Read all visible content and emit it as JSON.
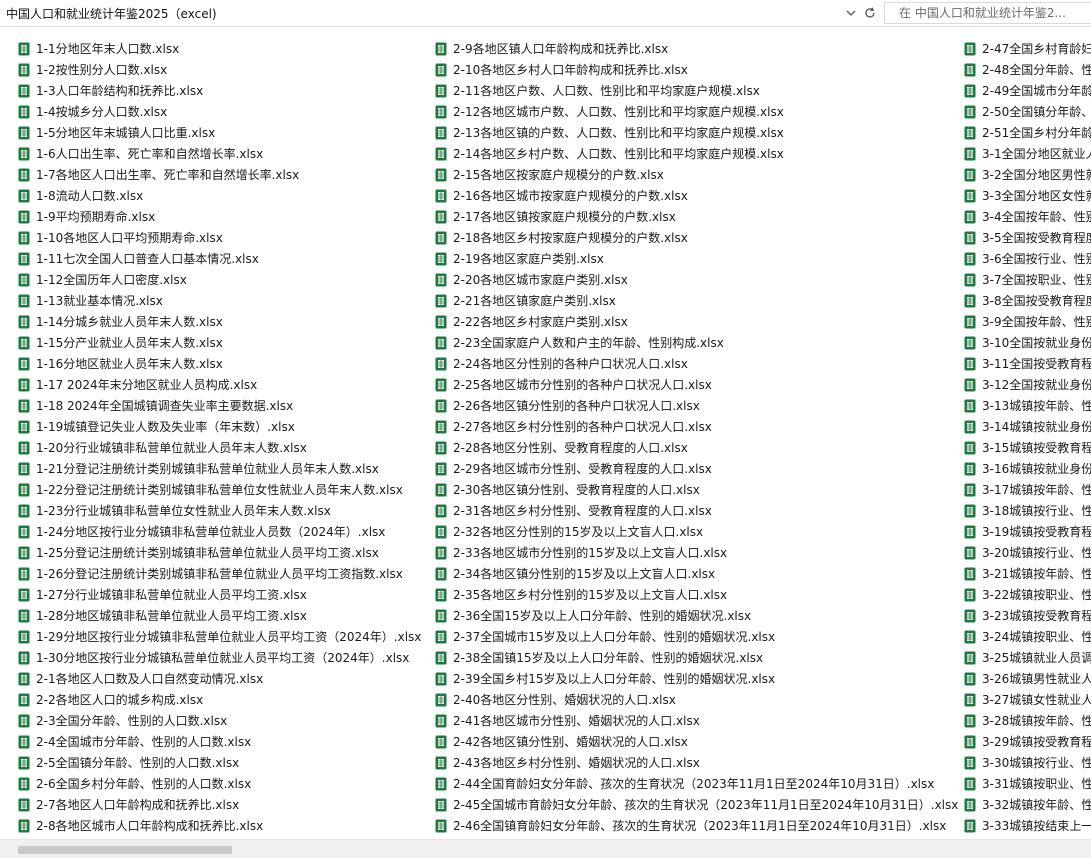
{
  "address_bar": {
    "path": "中国人口和就业统计年鉴2025（excel)",
    "search_placeholder": "在 中国人口和就业统计年鉴2..."
  },
  "icons": {
    "file_icon": "excel-file-icon",
    "dropdown": "chevron-down-icon",
    "refresh": "refresh-icon",
    "file_icon_color": "#1e7a3e"
  },
  "columns": [
    [
      "1-1分地区年末人口数.xlsx",
      "1-2按性别分人口数.xlsx",
      "1-3人口年龄结构和抚养比.xlsx",
      "1-4按城乡分人口数.xlsx",
      "1-5分地区年末城镇人口比重.xlsx",
      "1-6人口出生率、死亡率和自然增长率.xlsx",
      "1-7各地区人口出生率、死亡率和自然增长率.xlsx",
      "1-8流动人口数.xlsx",
      "1-9平均预期寿命.xlsx",
      "1-10各地区人口平均预期寿命.xlsx",
      "1-11七次全国人口普查人口基本情况.xlsx",
      "1-12全国历年人口密度.xlsx",
      "1-13就业基本情况.xlsx",
      "1-14分城乡就业人员年末人数.xlsx",
      "1-15分产业就业人员年末人数.xlsx",
      "1-16分地区就业人员年末人数.xlsx",
      "1-17 2024年末分地区就业人员构成.xlsx",
      "1-18 2024年全国城镇调查失业率主要数据.xlsx",
      "1-19城镇登记失业人数及失业率（年末数）.xlsx",
      "1-20分行业城镇非私营单位就业人员年末人数.xlsx",
      "1-21分登记注册统计类别城镇非私营单位就业人员年末人数.xlsx",
      "1-22分登记注册统计类别城镇非私营单位女性就业人员年末人数.xlsx",
      "1-23分行业城镇非私营单位女性就业人员年末人数.xlsx",
      "1-24分地区按行业分城镇非私营单位就业人员数（2024年）.xlsx",
      "1-25分登记注册统计类别城镇非私营单位就业人员平均工资.xlsx",
      "1-26分登记注册统计类别城镇非私营单位就业人员平均工资指数.xlsx",
      "1-27分行业城镇非私营单位就业人员平均工资.xlsx",
      "1-28分地区城镇非私营单位就业人员平均工资.xlsx",
      "1-29分地区按行业分城镇非私营单位就业人员平均工资（2024年）.xlsx",
      "1-30分地区按行业分城镇私营单位就业人员平均工资（2024年）.xlsx",
      "2-1各地区人口数及人口自然变动情况.xlsx",
      "2-2各地区人口的城乡构成.xlsx",
      "2-3全国分年龄、性别的人口数.xlsx",
      "2-4全国城市分年龄、性别的人口数.xlsx",
      "2-5全国镇分年龄、性别的人口数.xlsx",
      "2-6全国乡村分年龄、性别的人口数.xlsx",
      "2-7各地区人口年龄构成和抚养比.xlsx",
      "2-8各地区城市人口年龄构成和抚养比.xlsx"
    ],
    [
      "2-9各地区镇人口年龄构成和抚养比.xlsx",
      "2-10各地区乡村人口年龄构成和抚养比.xlsx",
      "2-11各地区户数、人口数、性别比和平均家庭户规模.xlsx",
      "2-12各地区城市户数、人口数、性别比和平均家庭户规模.xlsx",
      "2-13各地区镇的户数、人口数、性别比和平均家庭户规模.xlsx",
      "2-14各地区乡村户数、人口数、性别比和平均家庭户规模.xlsx",
      "2-15各地区按家庭户规模分的户数.xlsx",
      "2-16各地区城市按家庭户规模分的户数.xlsx",
      "2-17各地区镇按家庭户规模分的户数.xlsx",
      "2-18各地区乡村按家庭户规模分的户数.xlsx",
      "2-19各地区家庭户类别.xlsx",
      "2-20各地区城市家庭户类别.xlsx",
      "2-21各地区镇家庭户类别.xlsx",
      "2-22各地区乡村家庭户类别.xlsx",
      "2-23全国家庭户人数和户主的年龄、性别构成.xlsx",
      "2-24各地区分性别的各种户口状况人口.xlsx",
      "2-25各地区城市分性别的各种户口状况人口.xlsx",
      "2-26各地区镇分性别的各种户口状况人口.xlsx",
      "2-27各地区乡村分性别的各种户口状况人口.xlsx",
      "2-28各地区分性别、受教育程度的人口.xlsx",
      "2-29各地区城市分性别、受教育程度的人口.xlsx",
      "2-30各地区镇分性别、受教育程度的人口.xlsx",
      "2-31各地区乡村分性别、受教育程度的人口.xlsx",
      "2-32各地区分性别的15岁及以上文盲人口.xlsx",
      "2-33各地区城市分性别的15岁及以上文盲人口.xlsx",
      "2-34各地区镇分性别的15岁及以上文盲人口.xlsx",
      "2-35各地区乡村分性别的15岁及以上文盲人口.xlsx",
      "2-36全国15岁及以上人口分年龄、性别的婚姻状况.xlsx",
      "2-37全国城市15岁及以上人口分年龄、性别的婚姻状况.xlsx",
      "2-38全国镇15岁及以上人口分年龄、性别的婚姻状况.xlsx",
      "2-39全国乡村15岁及以上人口分年龄、性别的婚姻状况.xlsx",
      "2-40各地区分性别、婚姻状况的人口.xlsx",
      "2-41各地区城市分性别、婚姻状况的人口.xlsx",
      "2-42各地区镇分性别、婚姻状况的人口.xlsx",
      "2-43各地区乡村分性别、婚姻状况的人口.xlsx",
      "2-44全国育龄妇女分年龄、孩次的生育状况（2023年11月1日至2024年10月31日）.xlsx",
      "2-45全国城市育龄妇女分年龄、孩次的生育状况（2023年11月1日至2024年10月31日）.xlsx",
      "2-46全国镇育龄妇女分年龄、孩次的生育状况（2023年11月1日至2024年10月31日）.xlsx"
    ],
    [
      "2-47全国乡村育龄妇",
      "2-48全国分年龄、性",
      "2-49全国城市分年龄",
      "2-50全国镇分年龄、",
      "2-51全国乡村分年龄",
      "3-1全国分地区就业人",
      "3-2全国分地区男性就",
      "3-3全国分地区女性就",
      "3-4全国按年龄、性别",
      "3-5全国按受教育程度",
      "3-6全国按行业、性别",
      "3-7全国按职业、性别",
      "3-8全国按受教育程度",
      "3-9全国按年龄、性别",
      "3-10全国按就业身份",
      "3-11全国按受教育程",
      "3-12全国按就业身份",
      "3-13城镇按年龄、性",
      "3-14城镇按就业身份",
      "3-15城镇按受教育程",
      "3-16城镇按就业身份",
      "3-17城镇按年龄、性",
      "3-18城镇按行业、性",
      "3-19城镇按受教育程",
      "3-20城镇按行业、性",
      "3-21城镇按年龄、性",
      "3-22城镇按职业、性",
      "3-23城镇按受教育程",
      "3-24城镇按职业、性",
      "3-25城镇就业人员调",
      "3-26城镇男性就业人",
      "3-27城镇女性就业人",
      "3-28城镇按年龄、性",
      "3-29城镇按受教育程",
      "3-30城镇按行业、性",
      "3-31城镇按职业、性",
      "3-32城镇按年龄、性",
      "3-33城镇按结束上一"
    ]
  ]
}
